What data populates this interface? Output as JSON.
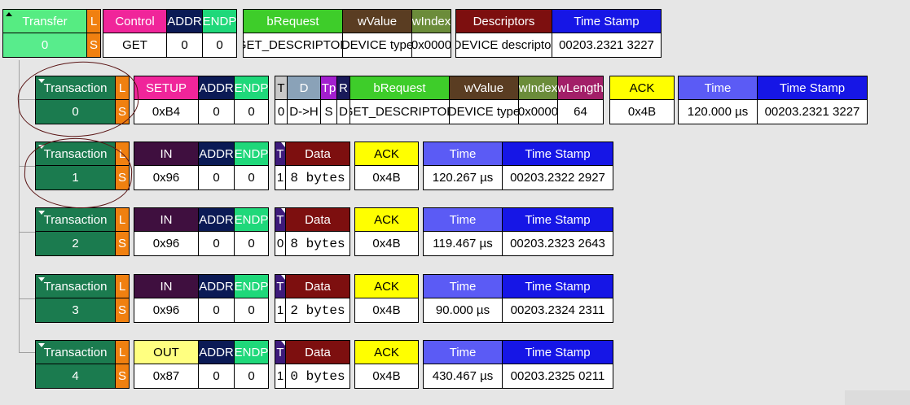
{
  "transfer": {
    "label": "Transfer",
    "id": "0",
    "l": "L",
    "s": "S",
    "control": "Control",
    "control_val": "GET",
    "addr": "ADDR",
    "addr_val": "0",
    "endp": "ENDP",
    "endp_val": "0",
    "brequest": "bRequest",
    "brequest_val": "GET_DESCRIPTOR",
    "wvalue": "wValue",
    "wvalue_val": "DEVICE type",
    "windex": "wIndex",
    "windex_val": "0x0000",
    "descriptors": "Descriptors",
    "descriptors_val": "DEVICE descriptor",
    "timestamp": "Time Stamp",
    "timestamp_val": "00203.2321 3227"
  },
  "transactions": [
    {
      "label": "Transaction",
      "id": "0",
      "l": "L",
      "s": "S",
      "pid": "SETUP",
      "pid_val": "0xB4",
      "addr": "ADDR",
      "addr_val": "0",
      "endp": "ENDP",
      "endp_val": "0",
      "t": "T",
      "t_val": "0",
      "d": "D",
      "d_val": "D->H",
      "tp": "Tp",
      "tp_val": "S",
      "r": "R",
      "r_val": "D",
      "brequest": "bRequest",
      "brequest_val": "GET_DESCRIPTOR",
      "wvalue": "wValue",
      "wvalue_val": "DEVICE type",
      "windex": "wIndex",
      "windex_val": "0x0000",
      "wlength": "wLength",
      "wlength_val": "64",
      "ack": "ACK",
      "ack_val": "0x4B",
      "time": "Time",
      "time_val": "120.000 µs",
      "timestamp": "Time Stamp",
      "timestamp_val": "00203.2321 3227"
    },
    {
      "label": "Transaction",
      "id": "1",
      "l": "L",
      "s": "S",
      "pid": "IN",
      "pid_val": "0x96",
      "addr": "ADDR",
      "addr_val": "0",
      "endp": "ENDP",
      "endp_val": "0",
      "t": "T",
      "t_val": "1",
      "data": "Data",
      "data_val": "8 bytes",
      "ack": "ACK",
      "ack_val": "0x4B",
      "time": "Time",
      "time_val": "120.267 µs",
      "timestamp": "Time Stamp",
      "timestamp_val": "00203.2322 2927"
    },
    {
      "label": "Transaction",
      "id": "2",
      "l": "L",
      "s": "S",
      "pid": "IN",
      "pid_val": "0x96",
      "addr": "ADDR",
      "addr_val": "0",
      "endp": "ENDP",
      "endp_val": "0",
      "t": "T",
      "t_val": "0",
      "data": "Data",
      "data_val": "8 bytes",
      "ack": "ACK",
      "ack_val": "0x4B",
      "time": "Time",
      "time_val": "119.467 µs",
      "timestamp": "Time Stamp",
      "timestamp_val": "00203.2323 2643"
    },
    {
      "label": "Transaction",
      "id": "3",
      "l": "L",
      "s": "S",
      "pid": "IN",
      "pid_val": "0x96",
      "addr": "ADDR",
      "addr_val": "0",
      "endp": "ENDP",
      "endp_val": "0",
      "t": "T",
      "t_val": "1",
      "data": "Data",
      "data_val": "2 bytes",
      "ack": "ACK",
      "ack_val": "0x4B",
      "time": "Time",
      "time_val": "90.000 µs",
      "timestamp": "Time Stamp",
      "timestamp_val": "00203.2324 2311"
    },
    {
      "label": "Transaction",
      "id": "4",
      "l": "L",
      "s": "S",
      "pid": "OUT",
      "pid_val": "0x87",
      "addr": "ADDR",
      "addr_val": "0",
      "endp": "ENDP",
      "endp_val": "0",
      "t": "T",
      "t_val": "1",
      "data": "Data",
      "data_val": "0 bytes",
      "ack": "ACK",
      "ack_val": "0x4B",
      "time": "Time",
      "time_val": "430.467 µs",
      "timestamp": "Time Stamp",
      "timestamp_val": "00203.2325 0211"
    }
  ],
  "colors": {
    "transaction": "#1b7b4f",
    "ls": "#f08010",
    "setup": "#f0259a",
    "in": "#3f0f3f",
    "out": "#ffff80",
    "addr": "#0b1a55",
    "endp": "#1fd87a",
    "ack": "#ffff00",
    "time": "#5b5bf5",
    "timestamp": "#1616e6",
    "data": "#7d0f0f"
  }
}
